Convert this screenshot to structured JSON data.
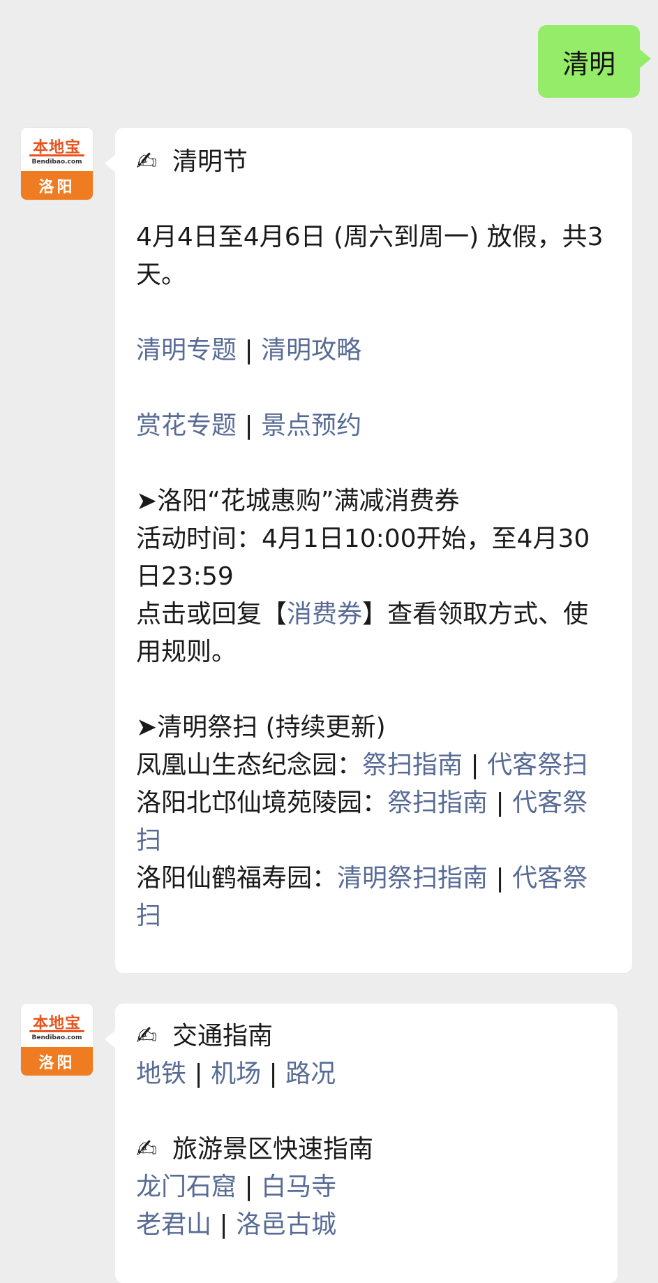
{
  "user_message": "清明",
  "avatar": {
    "logo_cn": "本地宝",
    "logo_en": "Bendibao.com",
    "city": "洛阳"
  },
  "msg1": {
    "title_icon": "✍",
    "title": "清明节",
    "holiday_line": "4月4日至4月6日 (周六到周一) 放假，共3天。",
    "links_row1": {
      "a": "清明专题",
      "b": "清明攻略"
    },
    "links_row2": {
      "a": "赏花专题",
      "b": "景点预约"
    },
    "sep": "|",
    "coupon": {
      "heading": "➤洛阳“花城惠购”满减消费券",
      "time": "活动时间：4月1日10:00开始，至4月30日23:59",
      "prefix": "点击或回复",
      "lb": "【",
      "keyword": "消费券",
      "rb": "】",
      "suffix": "查看领取方式、使用规则。"
    },
    "tomb": {
      "heading": "➤清明祭扫 (持续更新)",
      "items": [
        {
          "name": "凤凰山生态纪念园：",
          "guide": "祭扫指南",
          "proxy": "代客祭扫"
        },
        {
          "name": "洛阳北邙仙境苑陵园：",
          "guide": "祭扫指南",
          "proxy": "代客祭扫"
        },
        {
          "name": "洛阳仙鹤福寿园：",
          "guide": "清明祭扫指南",
          "proxy": "代客祭扫"
        }
      ]
    }
  },
  "msg2": {
    "title_icon": "✍",
    "traffic_title": "交通指南",
    "traffic_links": [
      "地铁",
      "机场",
      "路况"
    ],
    "scenic_title": "旅游景区快速指南",
    "scenic_row1": [
      "龙门石窟",
      "白马寺"
    ],
    "scenic_row2": [
      "老君山",
      "洛邑古城"
    ]
  }
}
